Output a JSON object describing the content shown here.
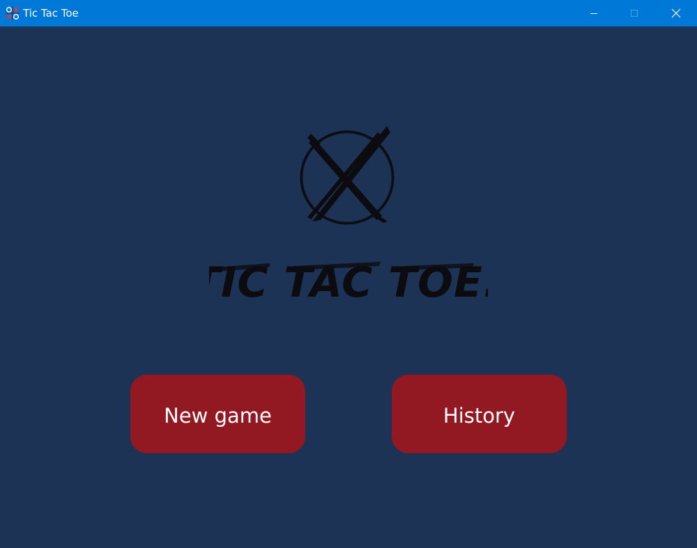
{
  "window": {
    "title": "Tic Tac Toe",
    "controls": [
      "minimize-icon",
      "maximize-icon",
      "close-icon"
    ]
  },
  "logo": {
    "text": "TIC TAC TOE."
  },
  "menu": {
    "new_game_label": "New game",
    "history_label": "History"
  },
  "colors": {
    "titlebar": "#0078d7",
    "background": "#1d3355",
    "button": "#921821",
    "button_text": "#ffffff",
    "logo": "#0b0b10"
  }
}
